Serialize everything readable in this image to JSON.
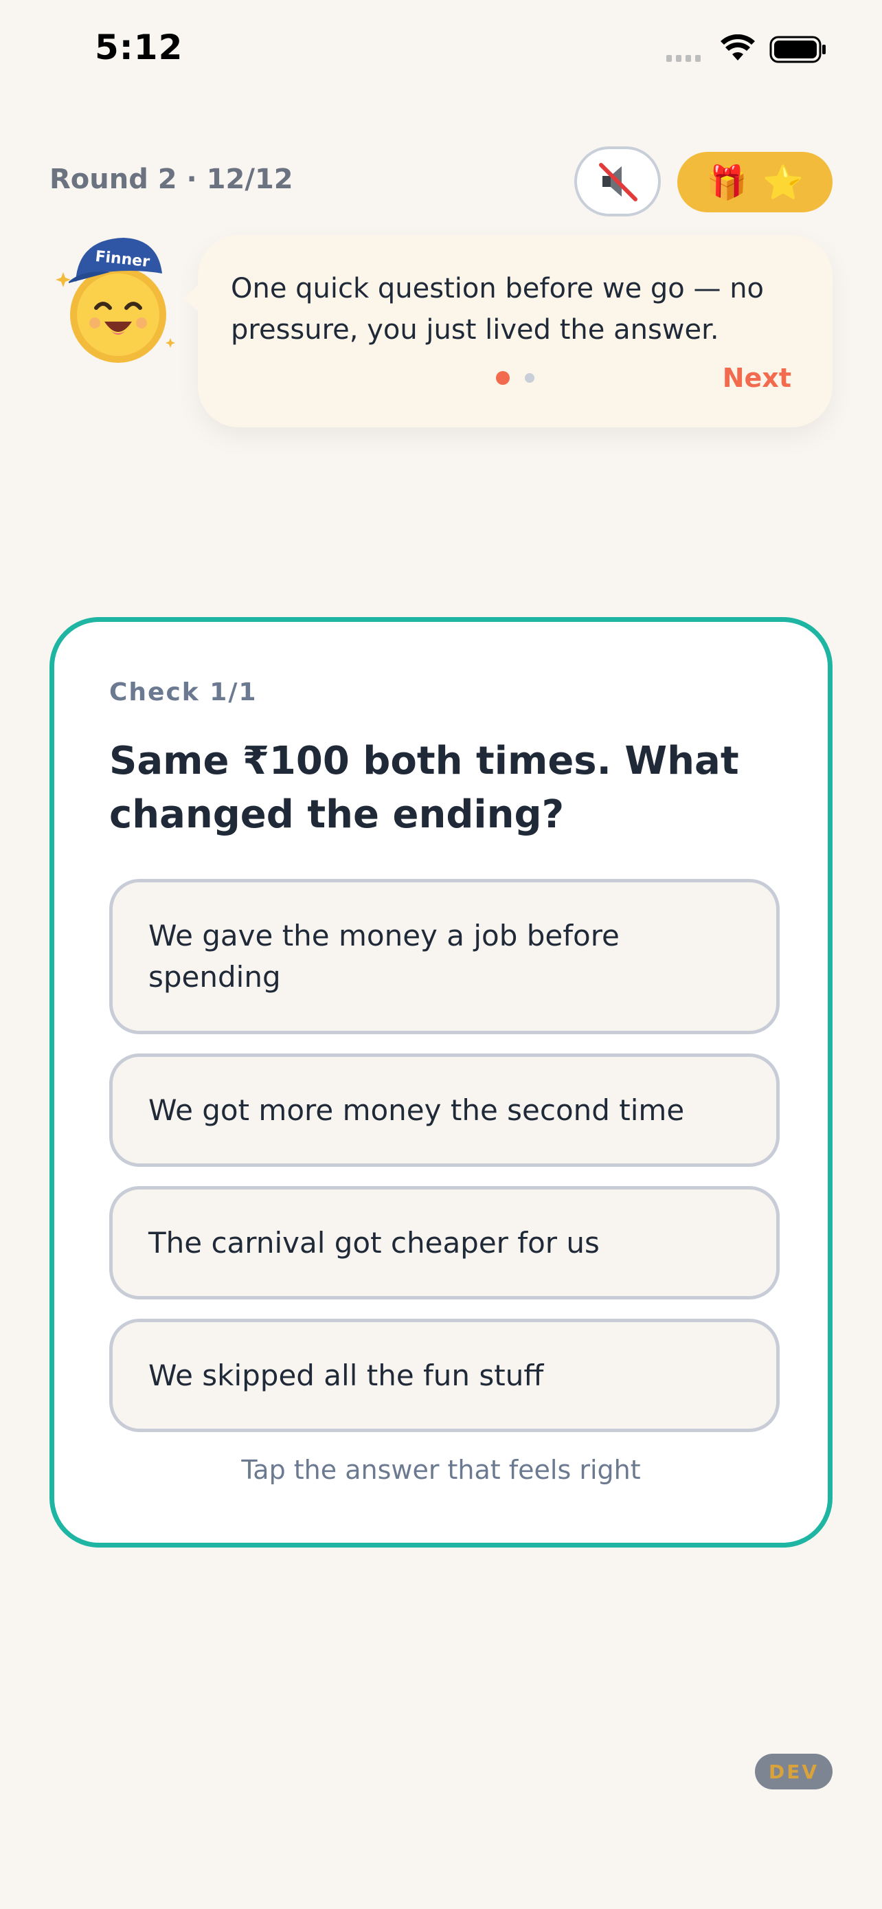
{
  "status_bar": {
    "time": "5:12"
  },
  "header": {
    "round_label": "Round 2 · 12/12"
  },
  "buttons": {
    "mute_icon": "muted-speaker-icon",
    "reward_icons": [
      "gift-icon",
      "star-icon"
    ],
    "reward_gift": "🎁",
    "reward_star": "⭐"
  },
  "mascot": {
    "cap_text": "Finner"
  },
  "speech": {
    "text": "One quick question before we go — no pressure, you just lived the answer.",
    "next_label": "Next",
    "page_dots": {
      "count": 2,
      "active": 1
    }
  },
  "question": {
    "check_label": "Check 1/1",
    "text": "Same ₹100 both times. What changed the ending?",
    "options": [
      "We gave the money a job before spending",
      "We got more money the second time",
      "The carnival got cheaper for us",
      "We skipped all the fun stuff"
    ],
    "hint": "Tap the answer that feels right"
  },
  "dev_badge": "DEV",
  "colors": {
    "background": "#f9f6f1",
    "card_border": "#1fb5a3",
    "accent": "#f26b4f",
    "reward": "#f2bb3c"
  }
}
